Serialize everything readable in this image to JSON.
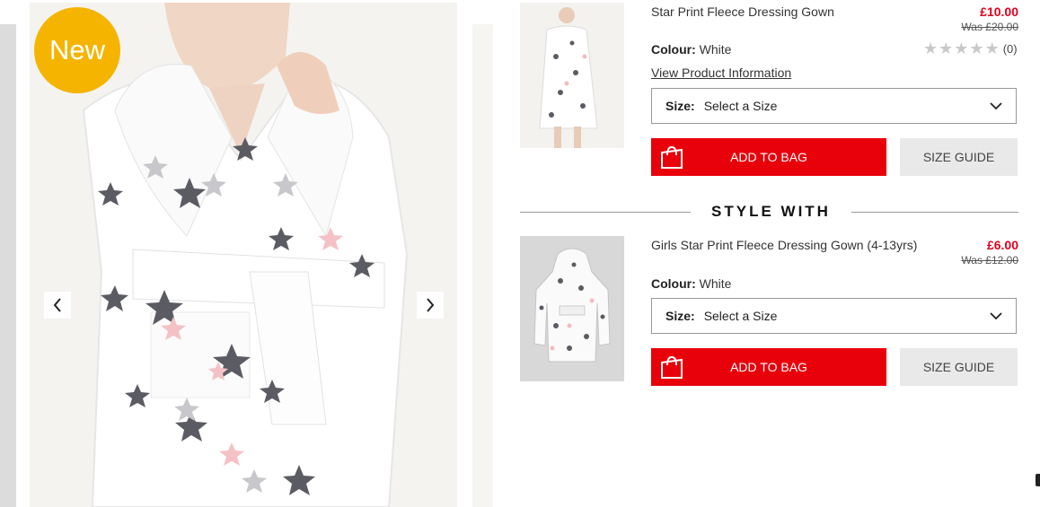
{
  "gallery": {
    "badge": "New",
    "prev_icon": "chevron-left-icon",
    "next_icon": "chevron-right-icon"
  },
  "product": {
    "name": "Star Print Fleece Dressing Gown",
    "price": "£10.00",
    "was_price": "Was £20.00",
    "colour_label": "Colour:",
    "colour_value": "White",
    "rating_stars": 0,
    "rating_count": "(0)",
    "view_info_link": "View Product Information",
    "size_label": "Size:",
    "size_placeholder": "Select a Size",
    "add_to_bag": "ADD TO BAG",
    "size_guide": "SIZE GUIDE"
  },
  "style_with": {
    "heading": "STYLE WITH"
  },
  "related": {
    "name": "Girls Star Print Fleece Dressing Gown (4-13yrs)",
    "price": "£6.00",
    "was_price": "Was £12.00",
    "colour_label": "Colour:",
    "colour_value": "White",
    "size_label": "Size:",
    "size_placeholder": "Select a Size",
    "add_to_bag": "ADD TO BAG",
    "size_guide": "SIZE GUIDE"
  },
  "colors": {
    "accent_red": "#e8000b",
    "price_red": "#e0001a",
    "badge_yellow": "#f5b400"
  }
}
